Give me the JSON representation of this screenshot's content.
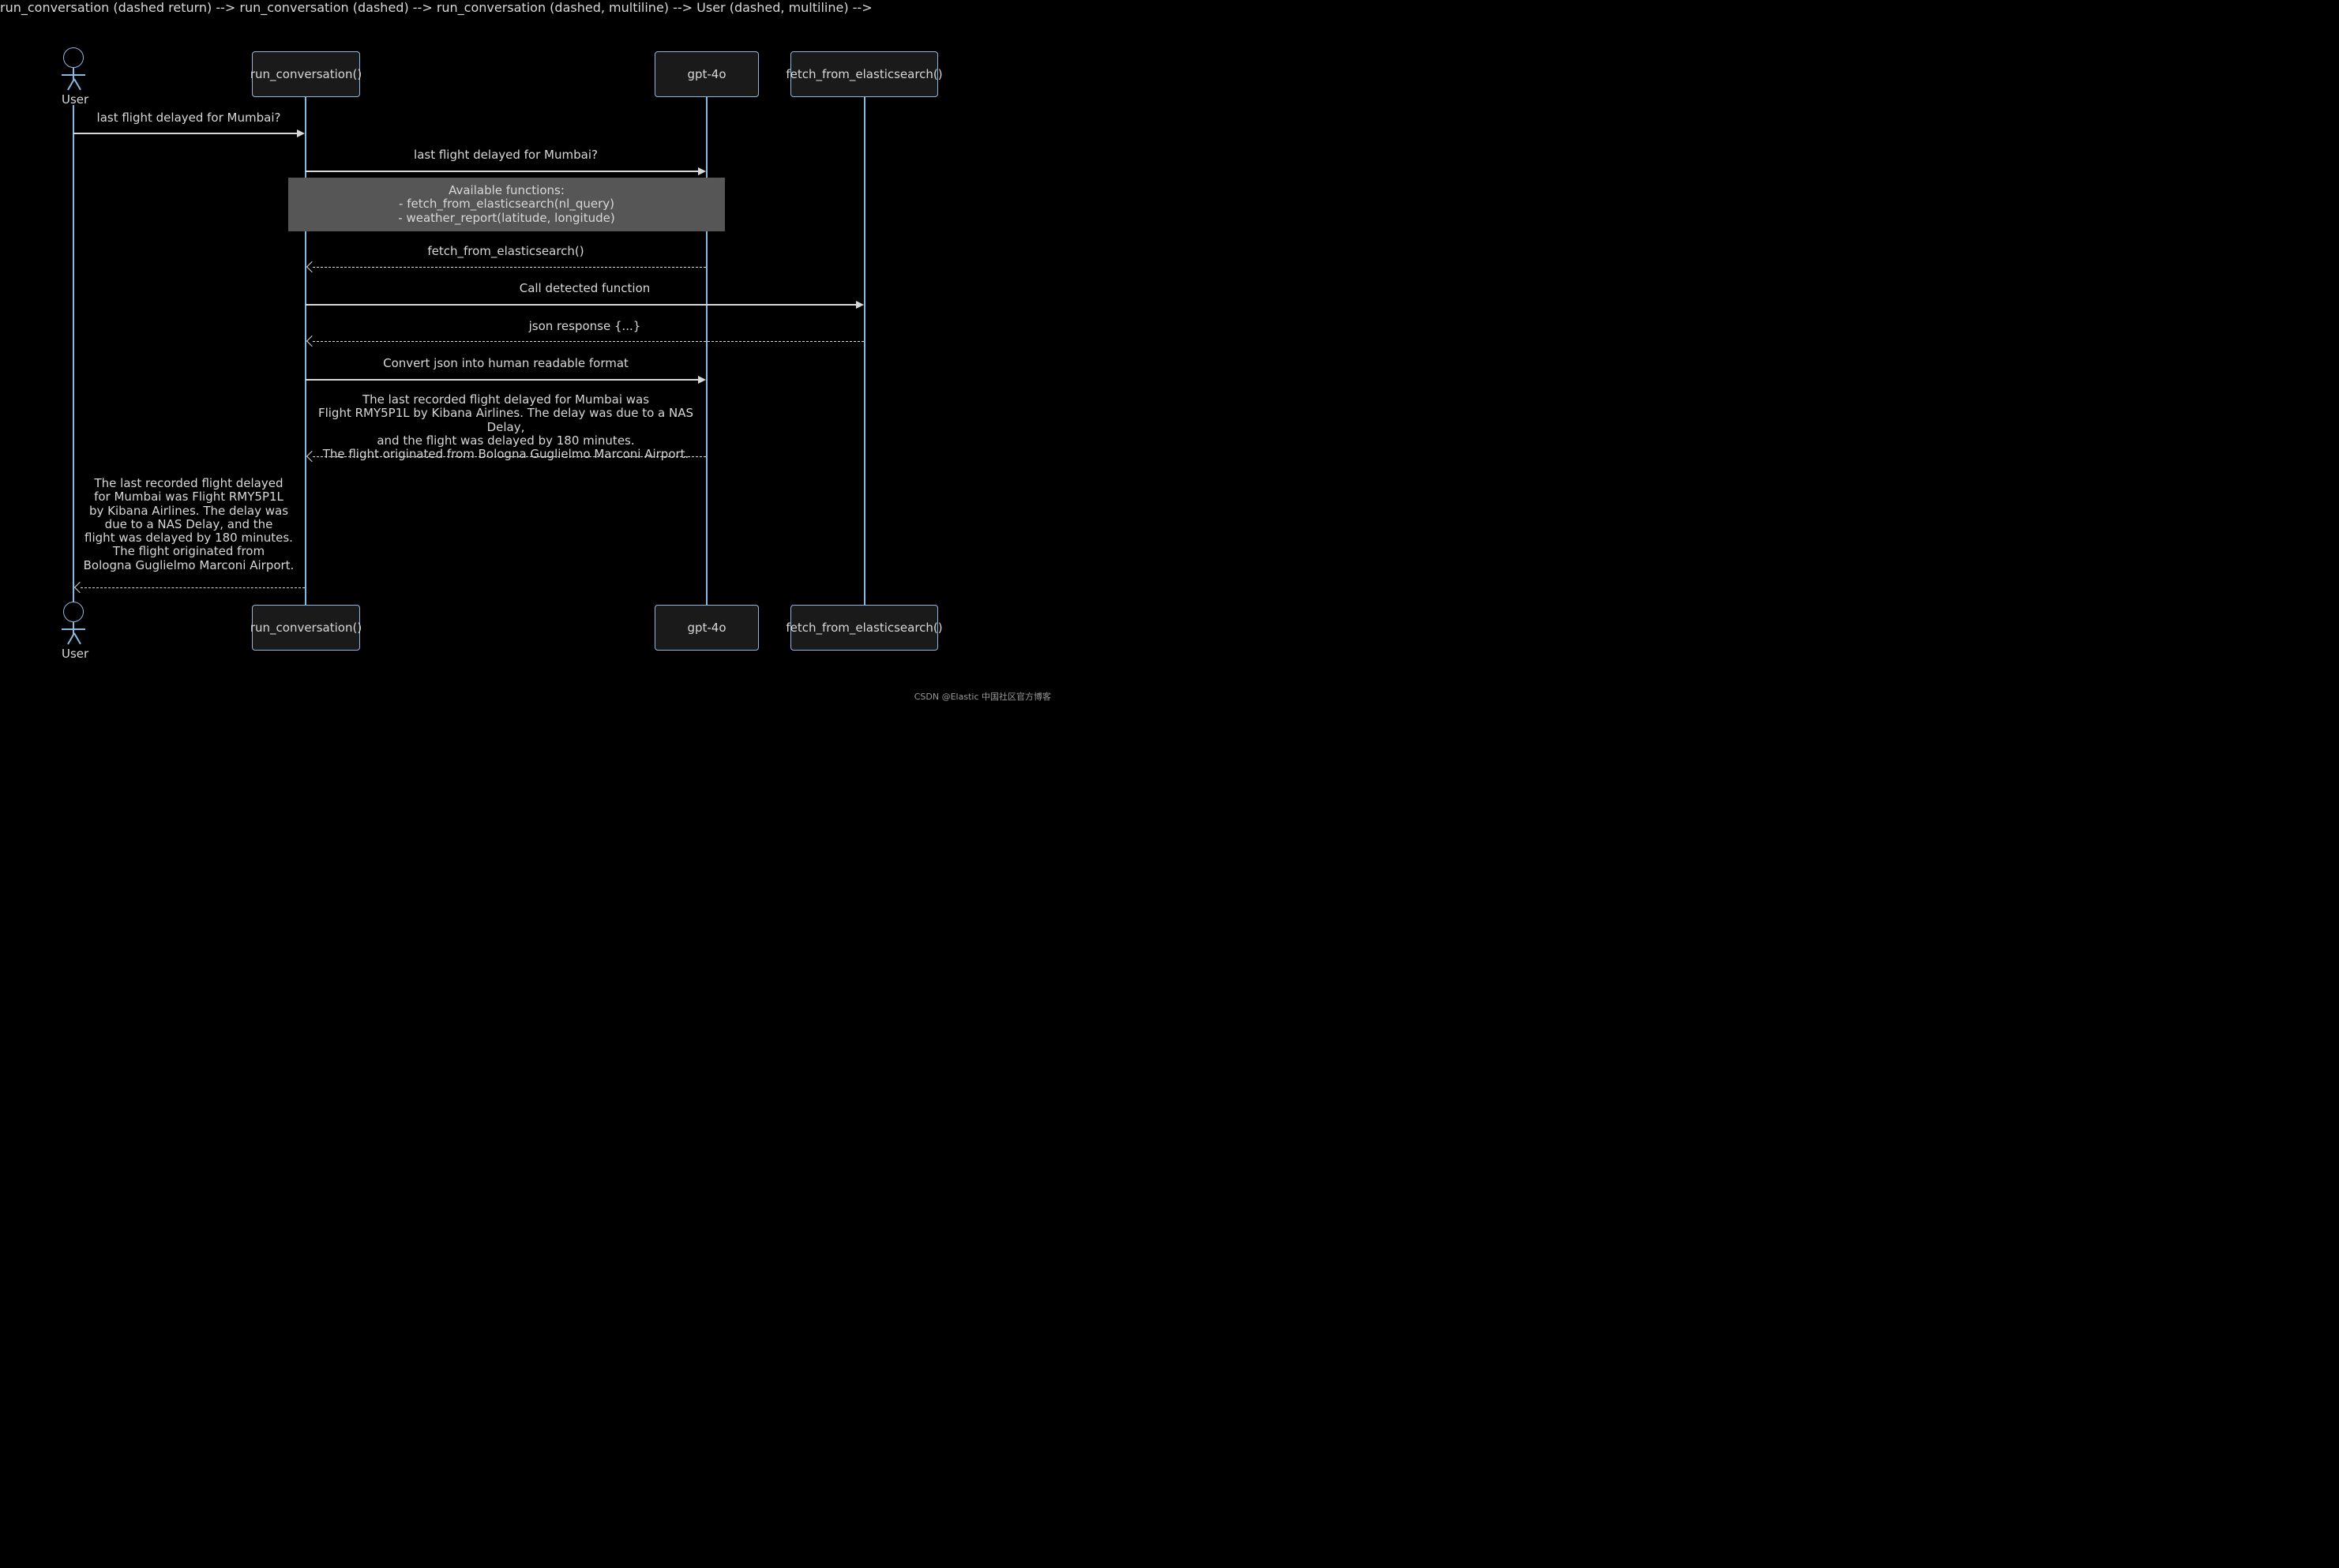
{
  "actors": {
    "user": {
      "name": "User"
    }
  },
  "participants": {
    "run_conversation": {
      "label": "run_conversation()"
    },
    "gpt4o": {
      "label": "gpt-4o"
    },
    "fetch_es": {
      "label": "fetch_from_elasticsearch()"
    }
  },
  "messages": {
    "m1": "last flight delayed for Mumbai?",
    "m2": "last flight delayed for Mumbai?",
    "note_functions": {
      "line1": "Available functions:",
      "line2": "- fetch_from_elasticsearch(nl_query)",
      "line3": "- weather_report(latitude, longitude)"
    },
    "m3": "fetch_from_elasticsearch()",
    "m4": "Call detected function",
    "m5": "json response {...}",
    "m6": "Convert json into human readable format",
    "m7": {
      "line1": "The last recorded flight delayed for Mumbai was",
      "line2": "Flight RMY5P1L by Kibana Airlines. The delay was due to a NAS Delay,",
      "line3": "and the flight was delayed by 180 minutes.",
      "line4": "The flight originated from Bologna Guglielmo Marconi Airport."
    },
    "m8": {
      "line1": "The last recorded flight delayed",
      "line2": "for Mumbai was Flight RMY5P1L",
      "line3": "by Kibana Airlines. The delay was",
      "line4": "due to a NAS Delay, and the",
      "line5": "flight was delayed by 180 minutes.",
      "line6": "The flight originated from",
      "line7": "Bologna Guglielmo Marconi Airport."
    }
  },
  "watermark": "CSDN @Elastic 中国社区官方博客"
}
